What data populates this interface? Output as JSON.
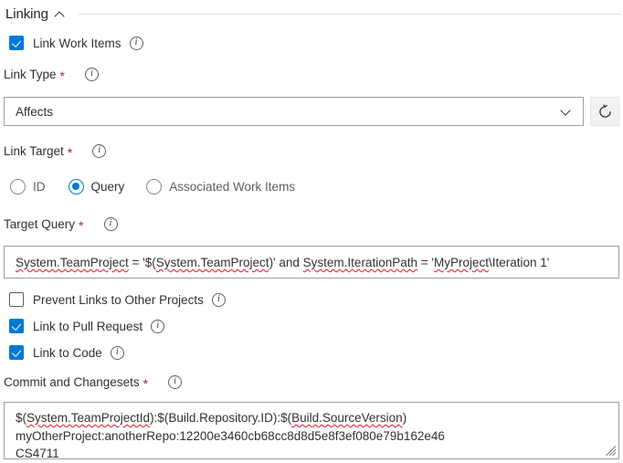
{
  "section": {
    "title": "Linking",
    "collapse_icon": "chevron-up-icon"
  },
  "link_work_items": {
    "label": "Link Work Items",
    "checked": true,
    "info_icon": "info-icon"
  },
  "link_type": {
    "label": "Link Type",
    "required_marker": "*",
    "info_icon": "info-icon",
    "selected_value": "Affects",
    "chevron_icon": "chevron-down-icon",
    "refresh_icon": "refresh-icon"
  },
  "link_target": {
    "label": "Link Target",
    "required_marker": "*",
    "info_icon": "info-icon",
    "options": [
      {
        "label": "ID",
        "selected": false
      },
      {
        "label": "Query",
        "selected": true
      },
      {
        "label": "Associated Work Items",
        "selected": false
      }
    ]
  },
  "target_query": {
    "label": "Target Query",
    "required_marker": "*",
    "info_icon": "info-icon",
    "value": "System.TeamProject = '$(System.TeamProject)' and System.IterationPath = 'MyProject\\Iteration 1'",
    "segments": [
      {
        "text": "System.TeamProject",
        "misspelled": true
      },
      {
        "text": " = '$(",
        "misspelled": false
      },
      {
        "text": "System.TeamProject",
        "misspelled": true
      },
      {
        "text": ")' and ",
        "misspelled": false
      },
      {
        "text": "System.IterationPath",
        "misspelled": true
      },
      {
        "text": " = '",
        "misspelled": false
      },
      {
        "text": "MyProject",
        "misspelled": true
      },
      {
        "text": "\\Iteration 1'",
        "misspelled": false
      }
    ]
  },
  "prevent_links": {
    "label": "Prevent Links to Other Projects",
    "checked": false,
    "info_icon": "info-icon"
  },
  "link_pull_request": {
    "label": "Link to Pull Request",
    "checked": true,
    "info_icon": "info-icon"
  },
  "link_to_code": {
    "label": "Link to Code",
    "checked": true,
    "info_icon": "info-icon"
  },
  "commit_changesets": {
    "label": "Commit and Changesets",
    "required_marker": "*",
    "info_icon": "info-icon",
    "lines": [
      "$(System.TeamProjectId):$(Build.Repository.ID):$(Build.SourceVersion)",
      "myOtherProject:anotherRepo:12200e3460cb68cc8d8d5e8f3ef080e79b162e46",
      "CS4711"
    ],
    "line1_segments": [
      {
        "text": "$(",
        "misspelled": false
      },
      {
        "text": "System.TeamProjectId",
        "misspelled": true
      },
      {
        "text": "):$(Build.Repository.ID):$(",
        "misspelled": false
      },
      {
        "text": "Build.SourceVersion",
        "misspelled": true
      },
      {
        "text": ")",
        "misspelled": false
      }
    ],
    "resize_icon": "resize-grip-icon"
  },
  "colors": {
    "accent": "#0078d4",
    "required": "#a4262c",
    "text": "#323130",
    "text_dim": "#605e5c",
    "border": "#a19f9d",
    "rule": "#e1dfdd",
    "spellcheck": "#e81123",
    "button_bg": "#f3f2f1"
  }
}
